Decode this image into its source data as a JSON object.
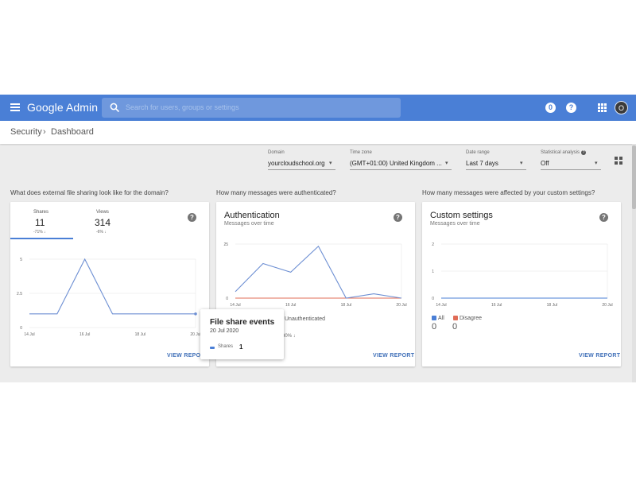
{
  "appbar": {
    "brand": "Google Admin",
    "search_placeholder": "Search for users, groups or settings",
    "notification_badge": "0",
    "help_label": "?",
    "avatar_initial": "O",
    "colors": {
      "bar": "#4a7fd6",
      "search": "#6f98dd"
    }
  },
  "breadcrumb": {
    "parent": "Security",
    "current": "Dashboard"
  },
  "filters": {
    "domain": {
      "label": "Domain",
      "value": "yourcloudschool.org"
    },
    "timezone": {
      "label": "Time zone",
      "value": "(GMT+01:00) United Kingdom ..."
    },
    "date_range": {
      "label": "Date range",
      "value": "Last 7 days"
    },
    "statistical_analysis": {
      "label": "Statistical analysis",
      "value": "Off"
    }
  },
  "cards": {
    "file_sharing": {
      "question": "What does external file sharing look like for the domain?",
      "tabs": [
        {
          "label": "Shares",
          "value": "11",
          "delta": "-71% ↓"
        },
        {
          "label": "Views",
          "value": "314",
          "delta": "-6% ↓"
        }
      ],
      "view_report": "VIEW REPORT"
    },
    "authentication": {
      "question": "How many messages were authenticated?",
      "title": "Authentication",
      "subtitle": "Messages over time",
      "legend_partial": "Unauthenticated",
      "legend_partial_value": "30% ↓",
      "view_report": "VIEW REPORT"
    },
    "custom_settings": {
      "question": "How many messages were affected by your custom settings?",
      "title": "Custom settings",
      "subtitle": "Messages over time",
      "legend": [
        {
          "label": "All",
          "value": "0",
          "color": "#4a7fd6"
        },
        {
          "label": "Disagree",
          "value": "0",
          "color": "#e06c57"
        }
      ],
      "view_report": "VIEW REPORT"
    }
  },
  "tooltip": {
    "title": "File share events",
    "date": "20 Jul 2020",
    "series": "Shares",
    "value": "1"
  },
  "chart_data": [
    {
      "type": "line",
      "x": [
        "14 Jul",
        "15 Jul",
        "16 Jul",
        "17 Jul",
        "18 Jul",
        "19 Jul",
        "20 Jul"
      ],
      "x_tick_labels": [
        "14 Jul",
        "16 Jul",
        "18 Jul",
        "20 Jul"
      ],
      "series": [
        {
          "name": "Shares",
          "values": [
            1,
            1,
            5,
            1,
            1,
            1,
            1
          ],
          "color": "#6d8fd3"
        }
      ],
      "y_ticks": [
        "0",
        "2.5",
        "5"
      ],
      "ylim": [
        0,
        5
      ],
      "grid": true
    },
    {
      "type": "line",
      "x": [
        "14 Jul",
        "15 Jul",
        "16 Jul",
        "17 Jul",
        "18 Jul",
        "19 Jul",
        "20 Jul"
      ],
      "x_tick_labels": [
        "14 Jul",
        "16 Jul",
        "18 Jul",
        "20 Jul"
      ],
      "series": [
        {
          "values": [
            3,
            16,
            12,
            24,
            0,
            2,
            0
          ],
          "color": "#6d8fd3"
        },
        {
          "name": "Unauthenticated",
          "values": [
            0,
            0,
            0,
            0,
            0,
            0,
            0
          ],
          "color": "#e06c57"
        }
      ],
      "y_ticks": [
        "0",
        "25"
      ],
      "ylim": [
        0,
        25
      ],
      "grid": true
    },
    {
      "type": "line",
      "x": [
        "14 Jul",
        "15 Jul",
        "16 Jul",
        "17 Jul",
        "18 Jul",
        "19 Jul",
        "20 Jul"
      ],
      "x_tick_labels": [
        "14 Jul",
        "16 Jul",
        "18 Jul",
        "20 Jul"
      ],
      "series": [
        {
          "name": "All",
          "values": [
            0,
            0,
            0,
            0,
            0,
            0,
            0
          ],
          "color": "#4a7fd6"
        },
        {
          "name": "Disagree",
          "values": [
            0,
            0,
            0,
            0,
            0,
            0,
            0
          ],
          "color": "#e06c57"
        }
      ],
      "y_ticks": [
        "0",
        "1",
        "2"
      ],
      "ylim": [
        0,
        2
      ],
      "grid": true
    }
  ]
}
